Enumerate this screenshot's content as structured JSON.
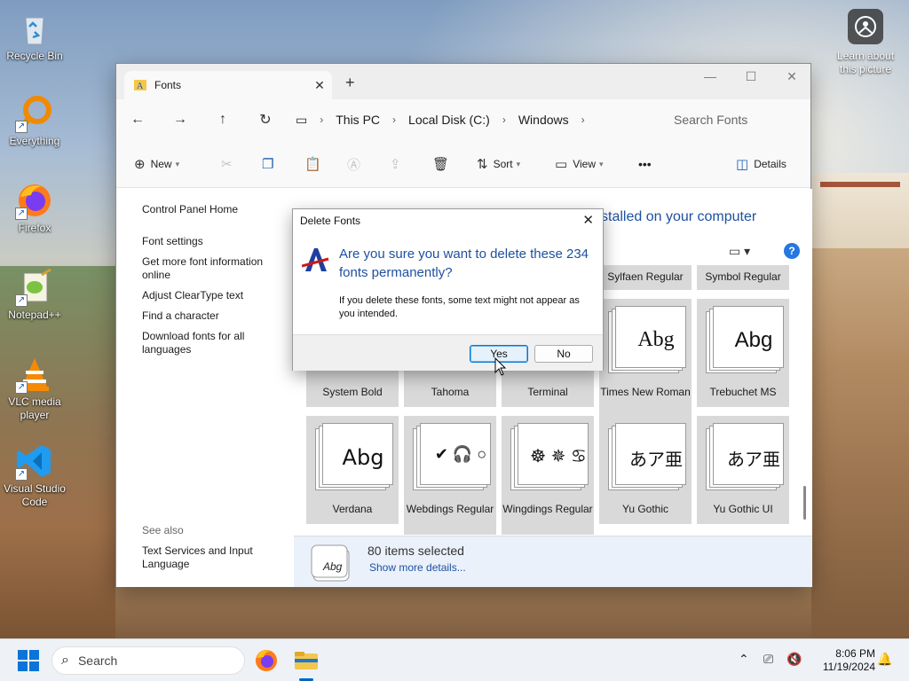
{
  "desktop": {
    "icons": [
      {
        "label": "Recycle Bin",
        "icon": "recycle-bin-icon"
      },
      {
        "label": "Everything",
        "icon": "everything-search-icon"
      },
      {
        "label": "Firefox",
        "icon": "firefox-icon"
      },
      {
        "label": "Notepad++",
        "icon": "notepad-plus-plus-icon"
      },
      {
        "label": "VLC media player",
        "icon": "vlc-icon"
      },
      {
        "label": "Visual Studio Code",
        "icon": "vscode-icon"
      }
    ],
    "learn_picture": "Learn about this picture"
  },
  "window": {
    "tab_title": "Fonts",
    "new_tab": "+",
    "breadcrumb": [
      "This PC",
      "Local Disk (C:)",
      "Windows"
    ],
    "search_placeholder": "Search Fonts",
    "commands": {
      "new": "New",
      "sort": "Sort",
      "view": "View",
      "more": "•••",
      "details": "Details"
    },
    "left_pane": {
      "home": "Control Panel Home",
      "links": [
        "Font settings",
        "Get more font information online",
        "Adjust ClearType text",
        "Find a character",
        "Download fonts for all languages"
      ],
      "see_also": "See also",
      "see_also_links": [
        "Text Services and Input Language"
      ]
    },
    "heading": "stalled on your computer",
    "fonts_row0": [
      "Sylfaen Regular",
      "Symbol Regular"
    ],
    "fonts_row1": [
      {
        "name": "System Bold",
        "sample": ""
      },
      {
        "name": "Tahoma",
        "sample": ""
      },
      {
        "name": "Terminal",
        "sample": ""
      },
      {
        "name": "Times New Roman",
        "sample": "Abg"
      },
      {
        "name": "Trebuchet MS",
        "sample": "Abg"
      }
    ],
    "fonts_row2": [
      {
        "name": "Verdana",
        "sample": "Abg"
      },
      {
        "name": "Webdings Regular",
        "sample": "✔ 🎧 ○"
      },
      {
        "name": "Wingdings Regular",
        "sample": "☸ ✵ ♋"
      },
      {
        "name": "Yu Gothic",
        "sample": "あア亜"
      },
      {
        "name": "Yu Gothic UI",
        "sample": "あア亜"
      }
    ],
    "status": {
      "count": "80 items selected",
      "more": "Show more details...",
      "icon_text": "Abg"
    }
  },
  "dialog": {
    "title": "Delete Fonts",
    "question": "Are you sure you want to delete these 234 fonts permanently?",
    "info": "If you delete these fonts, some text might not appear as you intended.",
    "yes": "Yes",
    "no": "No"
  },
  "taskbar": {
    "search": "Search",
    "time": "8:06 PM",
    "date": "11/19/2024"
  }
}
